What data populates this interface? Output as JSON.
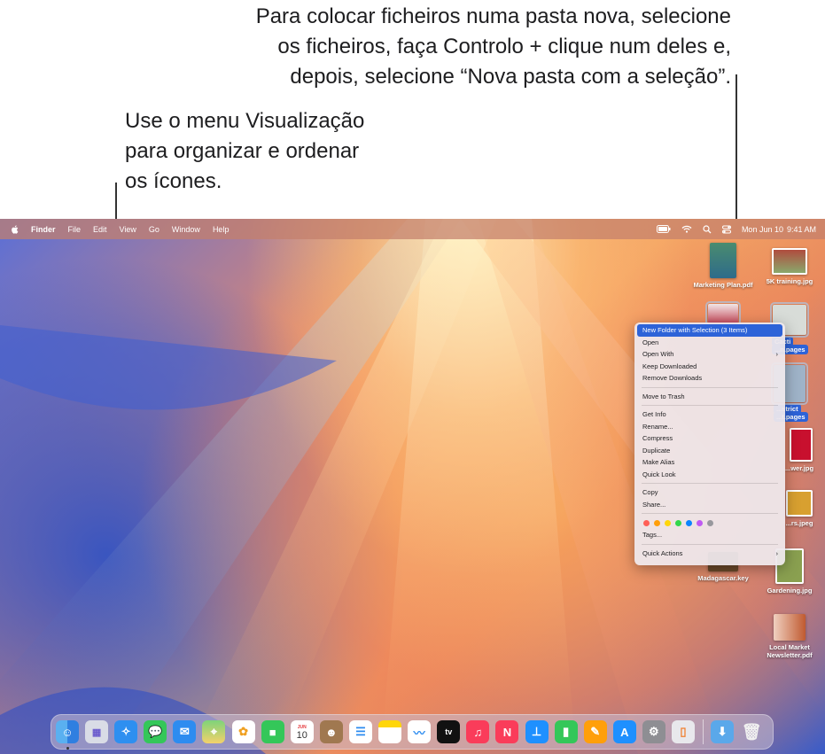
{
  "callouts": {
    "right": [
      "Para colocar ficheiros numa pasta nova, selecione",
      "os ficheiros, faça Controlo + clique num deles e,",
      "depois, selecione “Nova pasta com a seleção”."
    ],
    "left": [
      "Use o menu Visualização",
      "para organizar e ordenar",
      "os ícones."
    ]
  },
  "menubar": {
    "app_name": "Finder",
    "menus": [
      "File",
      "Edit",
      "View",
      "Go",
      "Window",
      "Help"
    ],
    "date": "Mon Jun 10",
    "time": "9:41 AM"
  },
  "desktop_icons": {
    "marketing": "Marketing Plan.pdf",
    "training": "5K training.jpg",
    "cacti_1": "Cacti",
    "cacti_2": "...n.pages",
    "district_1": "...strict",
    "district_2": "...t.pages",
    "flower": "...wer.jpg",
    "flowers": "...rs.jpeg",
    "madagascar": "Madagascar.key",
    "gardening": "Gardening.jpg",
    "newsletter_1": "Local Market",
    "newsletter_2": "Newsletter.pdf"
  },
  "context_menu": {
    "items_1": [
      "New Folder with Selection (3 Items)",
      "Open",
      "Open With",
      "Keep Downloaded",
      "Remove Downloads"
    ],
    "items_2": [
      "Move to Trash"
    ],
    "items_3": [
      "Get Info",
      "Rename...",
      "Compress",
      "Duplicate",
      "Make Alias",
      "Quick Look"
    ],
    "items_4": [
      "Copy",
      "Share..."
    ],
    "tag_colors": [
      "#ff5f57",
      "#ff9f0a",
      "#ffd60a",
      "#32d74b",
      "#0a84ff",
      "#bf5af2",
      "#98989d"
    ],
    "tags_label": "Tags...",
    "quick_actions": "Quick Actions"
  },
  "dock": {
    "calendar_month": "JUN",
    "calendar_day": "10",
    "tv_label": "tv",
    "apps": [
      "finder",
      "launchpad",
      "safari",
      "messages",
      "mail",
      "maps",
      "photos",
      "facetime",
      "calendar",
      "contacts",
      "reminders",
      "notes",
      "freeform",
      "tv",
      "music",
      "news",
      "keynote",
      "numbers",
      "pages",
      "app-store",
      "system-settings",
      "iphone-mirroring",
      "downloads",
      "trash"
    ]
  },
  "colors": {
    "menu_highlight": "#2d63d8",
    "menubar": "#c4806c"
  }
}
